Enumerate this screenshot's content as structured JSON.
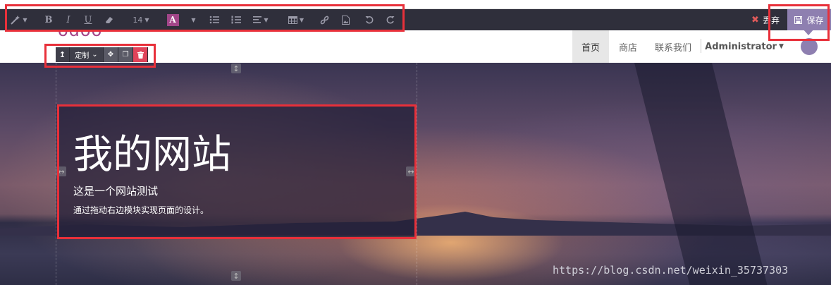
{
  "toolbar": {
    "font_size": "14",
    "discard_label": "丢弃",
    "save_label": "保存",
    "color_letter": "A",
    "colors": {
      "toolbar_bg": "#2f2f3b",
      "save_bg": "#8e7fb0",
      "color_swatch": "#a24689",
      "discard_icon": "#e05a5a"
    }
  },
  "navbar": {
    "items": [
      {
        "label": "首页"
      },
      {
        "label": "商店"
      },
      {
        "label": "联系我们"
      }
    ],
    "user_label": "Administrator"
  },
  "snippet_options": {
    "custom_label": "定制"
  },
  "hero": {
    "title": "我的网站",
    "subtitle": "这是一个网站测试",
    "description": "通过拖动右边模块实现页面的设计。"
  },
  "watermark": "https://blog.csdn.net/weixin_35737303",
  "annotation_color": "#e8303a"
}
